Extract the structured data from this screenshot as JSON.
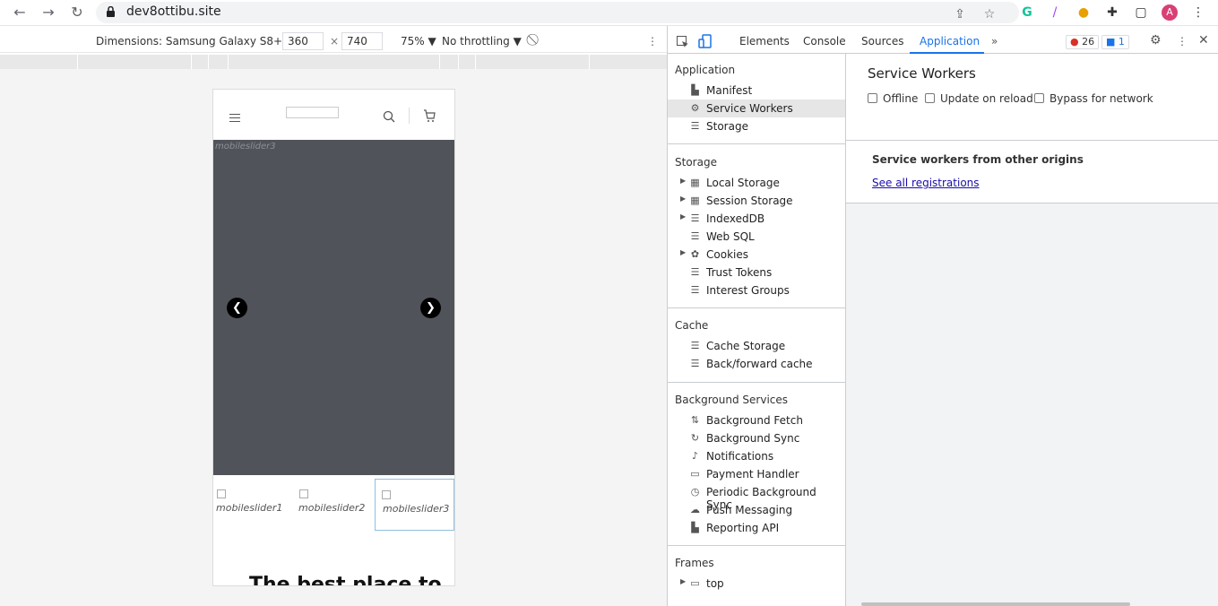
{
  "browser": {
    "url": "dev8ottibu.site",
    "avatar_letter": "A"
  },
  "device_toolbar": {
    "dimensions_label": "Dimensions: Samsung Galaxy S8+ ▼",
    "width": "360",
    "times": "×",
    "height": "740",
    "zoom": "75% ▼",
    "throttling": "No throttling ▼"
  },
  "phone": {
    "slider_alt": "mobileslider3",
    "thumbs": [
      "mobileslider1",
      "mobileslider2",
      "mobileslider3"
    ],
    "hero_text": "The best place to"
  },
  "devtools": {
    "tabs": [
      "Elements",
      "Console",
      "Sources",
      "Application"
    ],
    "more": "»",
    "errors": "26",
    "messages": "1",
    "sidebar": {
      "application_title": "Application",
      "application_items": [
        "Manifest",
        "Service Workers",
        "Storage"
      ],
      "storage_title": "Storage",
      "storage_items": [
        "Local Storage",
        "Session Storage",
        "IndexedDB",
        "Web SQL",
        "Cookies",
        "Trust Tokens",
        "Interest Groups"
      ],
      "cache_title": "Cache",
      "cache_items": [
        "Cache Storage",
        "Back/forward cache"
      ],
      "bg_title": "Background Services",
      "bg_items": [
        "Background Fetch",
        "Background Sync",
        "Notifications",
        "Payment Handler",
        "Periodic Background Sync",
        "Push Messaging",
        "Reporting API"
      ],
      "frames_title": "Frames",
      "frames_items": [
        "top"
      ]
    },
    "main": {
      "title": "Service Workers",
      "checkboxes": [
        "Offline",
        "Update on reload",
        "Bypass for network"
      ],
      "subtitle": "Service workers from other origins",
      "link": "See all registrations"
    }
  },
  "colors": {
    "accent": "#1a73e8",
    "slider_bg": "#505359"
  }
}
